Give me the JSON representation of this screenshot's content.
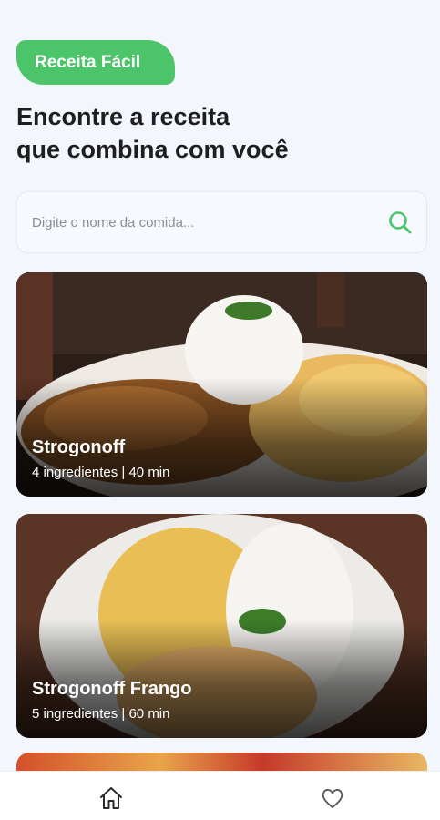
{
  "app": {
    "badge_label": "Receita Fácil"
  },
  "headline": {
    "line1": "Encontre a receita",
    "line2": "que combina com você"
  },
  "search": {
    "placeholder": "Digite o nome da comida...",
    "value": "",
    "icon": "search-icon"
  },
  "recipes": [
    {
      "title": "Strogonoff",
      "meta": "4 ingredientes | 40 min"
    },
    {
      "title": "Strogonoff Frango",
      "meta": "5 ingredientes | 60 min"
    }
  ],
  "nav": {
    "items": [
      {
        "icon": "home-icon",
        "active": true
      },
      {
        "icon": "heart-icon",
        "active": false
      }
    ]
  },
  "colors": {
    "accent": "#4cc46a",
    "background": "#f3f7fd"
  }
}
